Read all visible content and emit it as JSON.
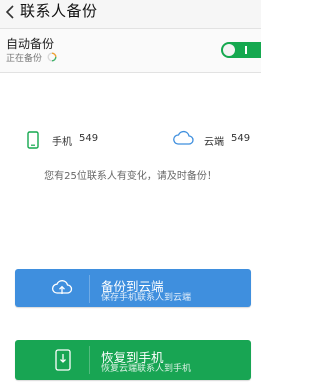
{
  "header": {
    "back_icon": "chevron-left-icon",
    "title": "联系人备份"
  },
  "auto_backup": {
    "title": "自动备份",
    "status": "正在备份",
    "toggle_on": true,
    "toggle_color": "#15a84f"
  },
  "summary": {
    "phone": {
      "icon": "phone-icon",
      "label": "手机",
      "count": "549"
    },
    "cloud": {
      "icon": "cloud-icon",
      "label": "云端",
      "count": "549"
    },
    "notice": "您有25位联系人有变化，请及时备份！"
  },
  "actions": {
    "backup": {
      "icon": "cloud-upload-icon",
      "title": "备份到云端",
      "subtitle": "保存手机联系人到云端",
      "color": "#3f8fde"
    },
    "restore": {
      "icon": "phone-download-icon",
      "title": "恢复到手机",
      "subtitle": "恢复云端联系人到手机",
      "color": "#18a553"
    }
  }
}
